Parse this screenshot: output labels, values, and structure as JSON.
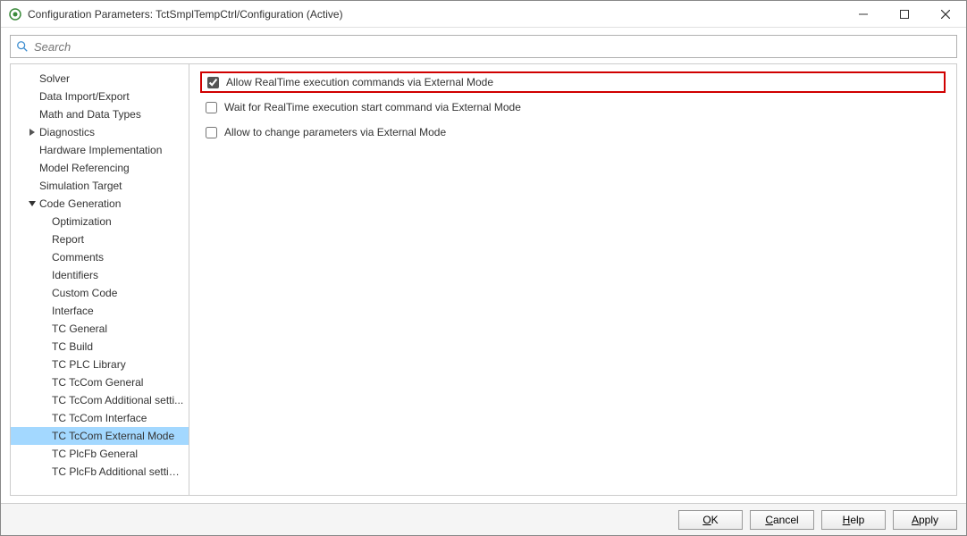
{
  "window": {
    "title": "Configuration Parameters: TctSmplTempCtrl/Configuration (Active)"
  },
  "search": {
    "placeholder": "Search",
    "value": ""
  },
  "sidebar": {
    "items": [
      {
        "label": "Solver",
        "level": 1,
        "arrow": "none",
        "selected": false
      },
      {
        "label": "Data Import/Export",
        "level": 1,
        "arrow": "none",
        "selected": false
      },
      {
        "label": "Math and Data Types",
        "level": 1,
        "arrow": "none",
        "selected": false
      },
      {
        "label": "Diagnostics",
        "level": 1,
        "arrow": "right",
        "selected": false
      },
      {
        "label": "Hardware Implementation",
        "level": 1,
        "arrow": "none",
        "selected": false
      },
      {
        "label": "Model Referencing",
        "level": 1,
        "arrow": "none",
        "selected": false
      },
      {
        "label": "Simulation Target",
        "level": 1,
        "arrow": "none",
        "selected": false
      },
      {
        "label": "Code Generation",
        "level": 1,
        "arrow": "down",
        "selected": false
      },
      {
        "label": "Optimization",
        "level": 2,
        "arrow": "none",
        "selected": false
      },
      {
        "label": "Report",
        "level": 2,
        "arrow": "none",
        "selected": false
      },
      {
        "label": "Comments",
        "level": 2,
        "arrow": "none",
        "selected": false
      },
      {
        "label": "Identifiers",
        "level": 2,
        "arrow": "none",
        "selected": false
      },
      {
        "label": "Custom Code",
        "level": 2,
        "arrow": "none",
        "selected": false
      },
      {
        "label": "Interface",
        "level": 2,
        "arrow": "none",
        "selected": false
      },
      {
        "label": "TC General",
        "level": 2,
        "arrow": "none",
        "selected": false
      },
      {
        "label": "TC Build",
        "level": 2,
        "arrow": "none",
        "selected": false
      },
      {
        "label": "TC PLC Library",
        "level": 2,
        "arrow": "none",
        "selected": false
      },
      {
        "label": "TC TcCom General",
        "level": 2,
        "arrow": "none",
        "selected": false
      },
      {
        "label": "TC TcCom Additional setti...",
        "level": 2,
        "arrow": "none",
        "selected": false
      },
      {
        "label": "TC TcCom Interface",
        "level": 2,
        "arrow": "none",
        "selected": false
      },
      {
        "label": "TC TcCom External Mode",
        "level": 2,
        "arrow": "none",
        "selected": true
      },
      {
        "label": "TC PlcFb General",
        "level": 2,
        "arrow": "none",
        "selected": false
      },
      {
        "label": "TC PlcFb Additional settings",
        "level": 2,
        "arrow": "none",
        "selected": false
      }
    ]
  },
  "options": [
    {
      "label": "Allow RealTime execution commands via External Mode",
      "checked": true,
      "highlighted": true,
      "enabled": true
    },
    {
      "label": "Wait for RealTime execution start command via External Mode",
      "checked": false,
      "highlighted": false,
      "enabled": true
    },
    {
      "label": "Allow to change parameters via External Mode",
      "checked": false,
      "highlighted": false,
      "enabled": true
    }
  ],
  "footer": {
    "ok": "OK",
    "cancel": "Cancel",
    "help": "Help",
    "apply": "Apply"
  }
}
